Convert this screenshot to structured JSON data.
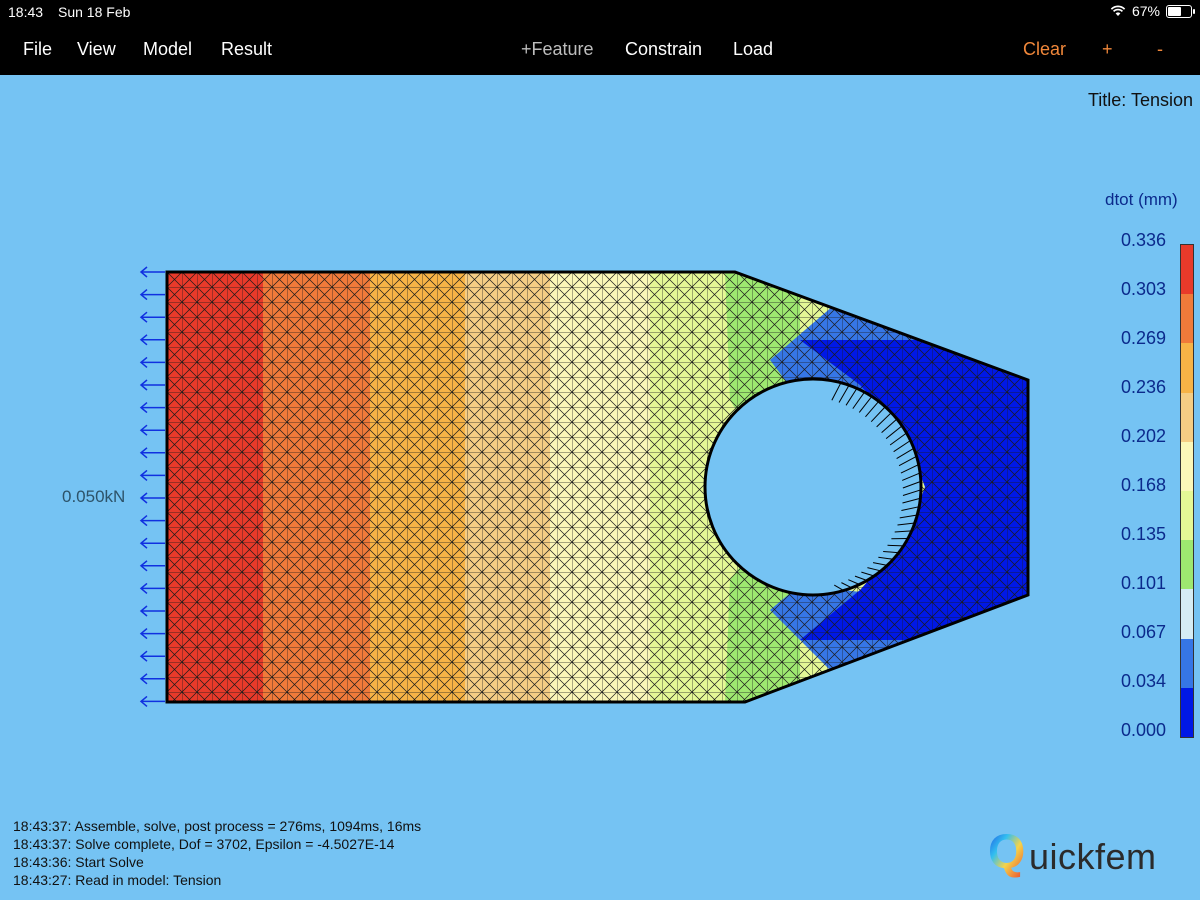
{
  "status_bar": {
    "time": "18:43",
    "date": "Sun 18 Feb",
    "battery": "67%",
    "battery_level": 0.67
  },
  "menu": {
    "file": "File",
    "view": "View",
    "model": "Model",
    "result": "Result",
    "feature": "+Feature",
    "constrain": "Constrain",
    "load": "Load",
    "clear": "Clear",
    "zoom_in": "+",
    "zoom_out": "-"
  },
  "model_title": "Title: Tension",
  "load_label": "0.050kN",
  "legend": {
    "title": "dtot (mm)",
    "ticks": [
      "0.336",
      "0.303",
      "0.269",
      "0.236",
      "0.202",
      "0.168",
      "0.135",
      "0.101",
      "0.067",
      "0.034",
      "0.000"
    ],
    "colors": [
      "#e83a2a",
      "#f07a3a",
      "#f7b346",
      "#f5cd84",
      "#fbf7b8",
      "#e5f896",
      "#9ee870",
      "#d6ecf4",
      "#3676e6",
      "#0018e6"
    ]
  },
  "log": [
    "18:43:37: Assemble, solve, post process = 276ms, 1094ms, 16ms",
    "18:43:37: Solve complete, Dof = 3702, Epsilon = -4.5027E-14",
    "18:43:36: Start Solve",
    "18:43:27: Read in model: Tension"
  ],
  "logo": {
    "q_letter": "Q",
    "rest": "uickfem"
  }
}
